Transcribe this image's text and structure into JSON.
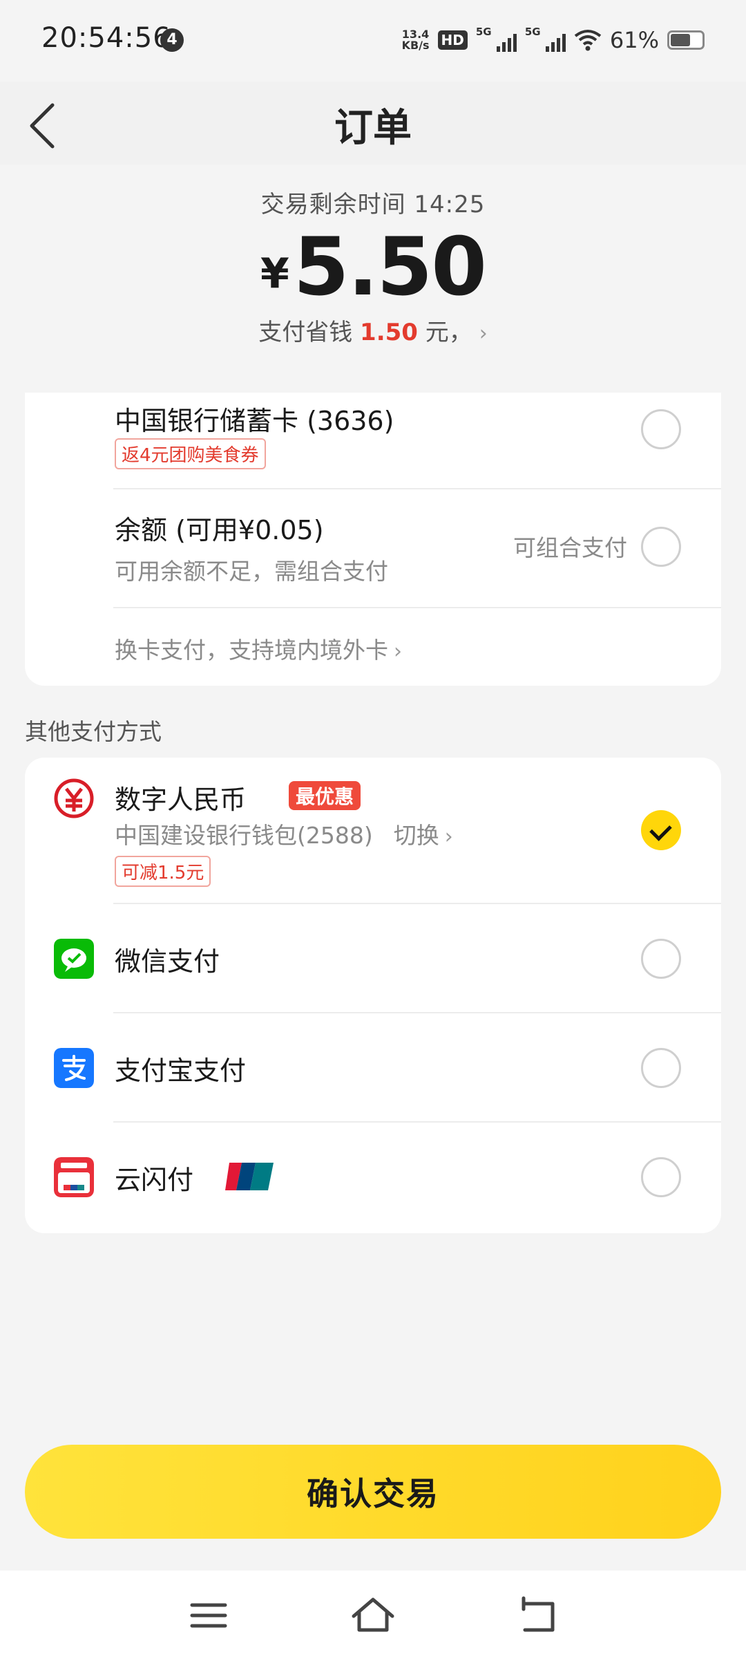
{
  "status_bar": {
    "time": "20:54:56",
    "notification_count": "4",
    "net_speed_value": "13.4",
    "net_speed_unit": "KB/s",
    "hd_label": "HD",
    "signal1_label": "5G",
    "signal2_label": "5G",
    "battery_percent": "61%"
  },
  "header": {
    "title": "订单"
  },
  "summary": {
    "remaining_label": "交易剩余时间 14:25",
    "currency": "¥",
    "amount": "5.50",
    "discount_prefix": "支付省钱 ",
    "discount_value": "1.50",
    "discount_suffix": " 元，"
  },
  "bank_card": {
    "name": "中国银行储蓄卡 (3636)",
    "promo": "返4元团购美食券"
  },
  "balance": {
    "name": "余额 (可用¥0.05)",
    "note": "可用余额不足，需组合支付",
    "combo_label": "可组合支付"
  },
  "change_card": {
    "label": "换卡支付，支持境内境外卡"
  },
  "other_methods": {
    "title": "其他支付方式",
    "digital_rmb": {
      "name": "数字人民币",
      "badge": "最优惠",
      "wallet": "中国建设银行钱包(2588)",
      "switch_label": "切换",
      "promo": "可减1.5元",
      "selected": true
    },
    "wechat": {
      "name": "微信支付"
    },
    "alipay": {
      "name": "支付宝支付"
    },
    "unionpay": {
      "name": "云闪付"
    }
  },
  "confirm_button": {
    "label": "确认交易"
  },
  "colors": {
    "accent": "#ffd60a",
    "red": "#e33b2e",
    "wechat": "#09bb07",
    "alipay": "#1677ff"
  }
}
